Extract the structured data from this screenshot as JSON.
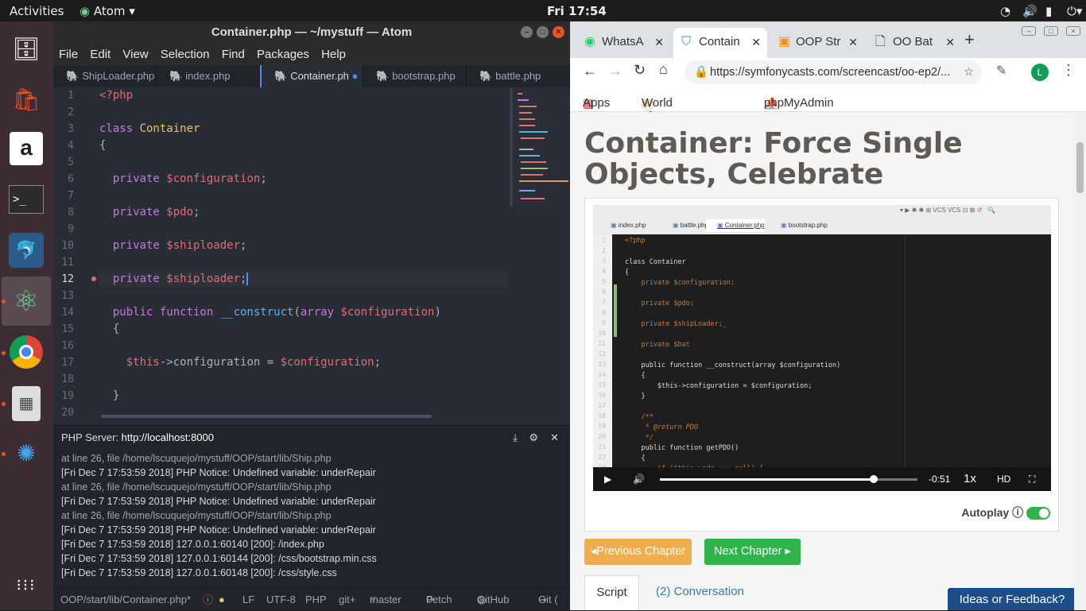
{
  "topbar": {
    "activities": "Activities",
    "app": "Atom",
    "clock": "Fri 17:54"
  },
  "dock": [
    {
      "name": "files-icon",
      "glyph": "🗄"
    },
    {
      "name": "software-icon",
      "glyph": "A"
    },
    {
      "name": "amazon-icon",
      "glyph": "a"
    },
    {
      "name": "terminal-icon",
      "glyph": ">_"
    },
    {
      "name": "mysql-workbench-icon",
      "glyph": "🐬"
    },
    {
      "name": "atom-icon",
      "glyph": "⚛"
    },
    {
      "name": "chrome-icon",
      "glyph": "◉"
    },
    {
      "name": "calculator-icon",
      "glyph": "▦"
    },
    {
      "name": "app-icon",
      "glyph": "✺"
    },
    {
      "name": "show-apps-icon",
      "glyph": "⋮⋮⋮"
    }
  ],
  "atom": {
    "title": "Container.php — ~/mystuff — Atom",
    "menu": [
      "File",
      "Edit",
      "View",
      "Selection",
      "Find",
      "Packages",
      "Help"
    ],
    "tabs": [
      "ShipLoader.php",
      "index.php",
      "Container.ph",
      "bootstrap.php",
      "battle.php"
    ],
    "lines": [
      "1",
      "2",
      "3",
      "4",
      "5",
      "6",
      "7",
      "8",
      "9",
      "10",
      "11",
      "12",
      "13",
      "14",
      "15",
      "16",
      "17",
      "18",
      "19",
      "20"
    ],
    "code": {
      "l1": "<?php",
      "l3a": "class ",
      "l3b": "Container",
      "l4": "{",
      "l6a": "  private ",
      "l6b": "$configuration",
      ";": ";",
      "l8b": "$pdo",
      "l10b": "$shiploader",
      "l12b": "$shiploader",
      "l14a": "  public function ",
      "l14b": "__construct",
      "l14c": "(",
      "l14d": "array ",
      "l14e": "$configuration",
      "l14f": ")",
      "l15": "  {",
      "l17a": "    ",
      "l17b": "$this",
      "l17c": "->configuration = ",
      "l17d": "$configuration",
      "l17e": ";",
      "l19": "  }"
    },
    "server_label": "PHP Server:",
    "server_url": "http://localhost:8000",
    "logs": [
      "at line 26, file /home/lscuquejo/mystuff/OOP/start/lib/Ship.php",
      "[Fri Dec 7 17:53:59 2018] PHP Notice: Undefined variable: underRepair",
      "at line 26, file /home/lscuquejo/mystuff/OOP/start/lib/Ship.php",
      "[Fri Dec 7 17:53:59 2018] PHP Notice: Undefined variable: underRepair",
      "at line 26, file /home/lscuquejo/mystuff/OOP/start/lib/Ship.php",
      "[Fri Dec 7 17:53:59 2018] PHP Notice: Undefined variable: underRepair",
      "[Fri Dec 7 17:53:59 2018] 127.0.0.1:60140 [200]: /index.php",
      "[Fri Dec 7 17:53:59 2018] 127.0.0.1:60144 [200]: /css/bootstrap.min.css",
      "[Fri Dec 7 17:53:59 2018] 127.0.0.1:60148 [200]: /css/style.css"
    ],
    "status": {
      "file": "OOP/start/lib/Container.php*",
      "enc": "LF",
      "charset": "UTF-8",
      "grammar": "PHP",
      "git": "git+",
      "branch": "master",
      "fetch": "Fetch",
      "github": "GitHub",
      "gitpanel": "Git ("
    }
  },
  "chrome": {
    "tabs": [
      "WhatsA",
      "Contain",
      "OOP Str",
      "OO Bat"
    ],
    "url": "https://symfonycasts.com/screencast/oo-ep2/...",
    "profile": "L",
    "bookmarks": [
      "Apps",
      "World of Warcra",
      "phpMyAdmin"
    ],
    "title": "Container: Force Single Objects, Celebrate",
    "video_tabs": [
      "index.php",
      "battle.php",
      "Container.php",
      "bootstrap.php"
    ],
    "video_lines": [
      "1",
      "2",
      "3",
      "4",
      "5",
      "6",
      "7",
      "8",
      "9",
      "10",
      "11",
      "12",
      "13",
      "14",
      "15",
      "16",
      "17",
      "18",
      "19",
      "20",
      "21",
      "22",
      "23"
    ],
    "video_code": {
      "c1": "<?php",
      "c3": "class Container",
      "c4": "{",
      "c5": "    private $configuration;",
      "c7": "    private $pdo;",
      "c9": "    private $shipLoader;_",
      "c11": "    private $bat",
      "c13": "    public function __construct(array $configuration)",
      "c14": "    {",
      "c15": "        $this->configuration = $configuration;",
      "c16": "    }",
      "c18": "    /**",
      "c19": "     * @return PDO",
      "c20": "     */",
      "c21": "    public function getPDO()",
      "c22": "    {",
      "c23": "        if ($this->pdo === null) {"
    },
    "video_time": "-0:51",
    "video_progress": 0.83,
    "video_speed": "1x",
    "video_hd": "HD",
    "autoplay": "Autoplay",
    "prev": "Previous Chapter",
    "next": "Next Chapter",
    "page_tabs": [
      "Script",
      "(2) Conversation"
    ],
    "feedback": "Ideas or Feedback?"
  }
}
